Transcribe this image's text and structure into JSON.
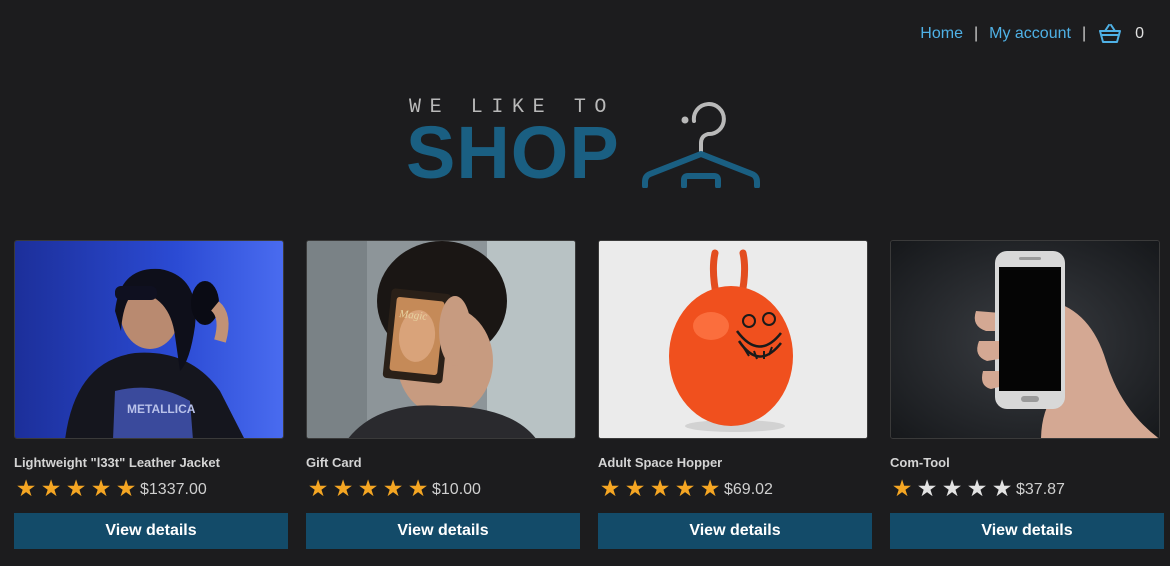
{
  "nav": {
    "home": "Home",
    "separator": "|",
    "account": "My account",
    "cart_icon": "basket-icon",
    "cart_count": "0"
  },
  "logo": {
    "tagline": "WE LIKE TO",
    "brand": "SHOP",
    "icon": "hanger-icon"
  },
  "colors": {
    "background": "#1c1c1e",
    "link": "#4fb1e6",
    "brand": "#1a5f82",
    "button": "#134b69",
    "star_on": "#f5a623",
    "star_off": "#e3e3e3"
  },
  "products": [
    {
      "name": "Lightweight \"l33t\" Leather Jacket",
      "rating": 5,
      "max_rating": 5,
      "price": "$1337.00",
      "button": "View details",
      "image": "woman-in-headphones-photo"
    },
    {
      "name": "Gift Card",
      "rating": 5,
      "max_rating": 5,
      "price": "$10.00",
      "button": "View details",
      "image": "man-holding-card-photo"
    },
    {
      "name": "Adult Space Hopper",
      "rating": 5,
      "max_rating": 5,
      "price": "$69.02",
      "button": "View details",
      "image": "space-hopper-photo"
    },
    {
      "name": "Com-Tool",
      "rating": 1,
      "max_rating": 5,
      "price": "$37.87",
      "button": "View details",
      "image": "hand-holding-phone-photo"
    }
  ]
}
